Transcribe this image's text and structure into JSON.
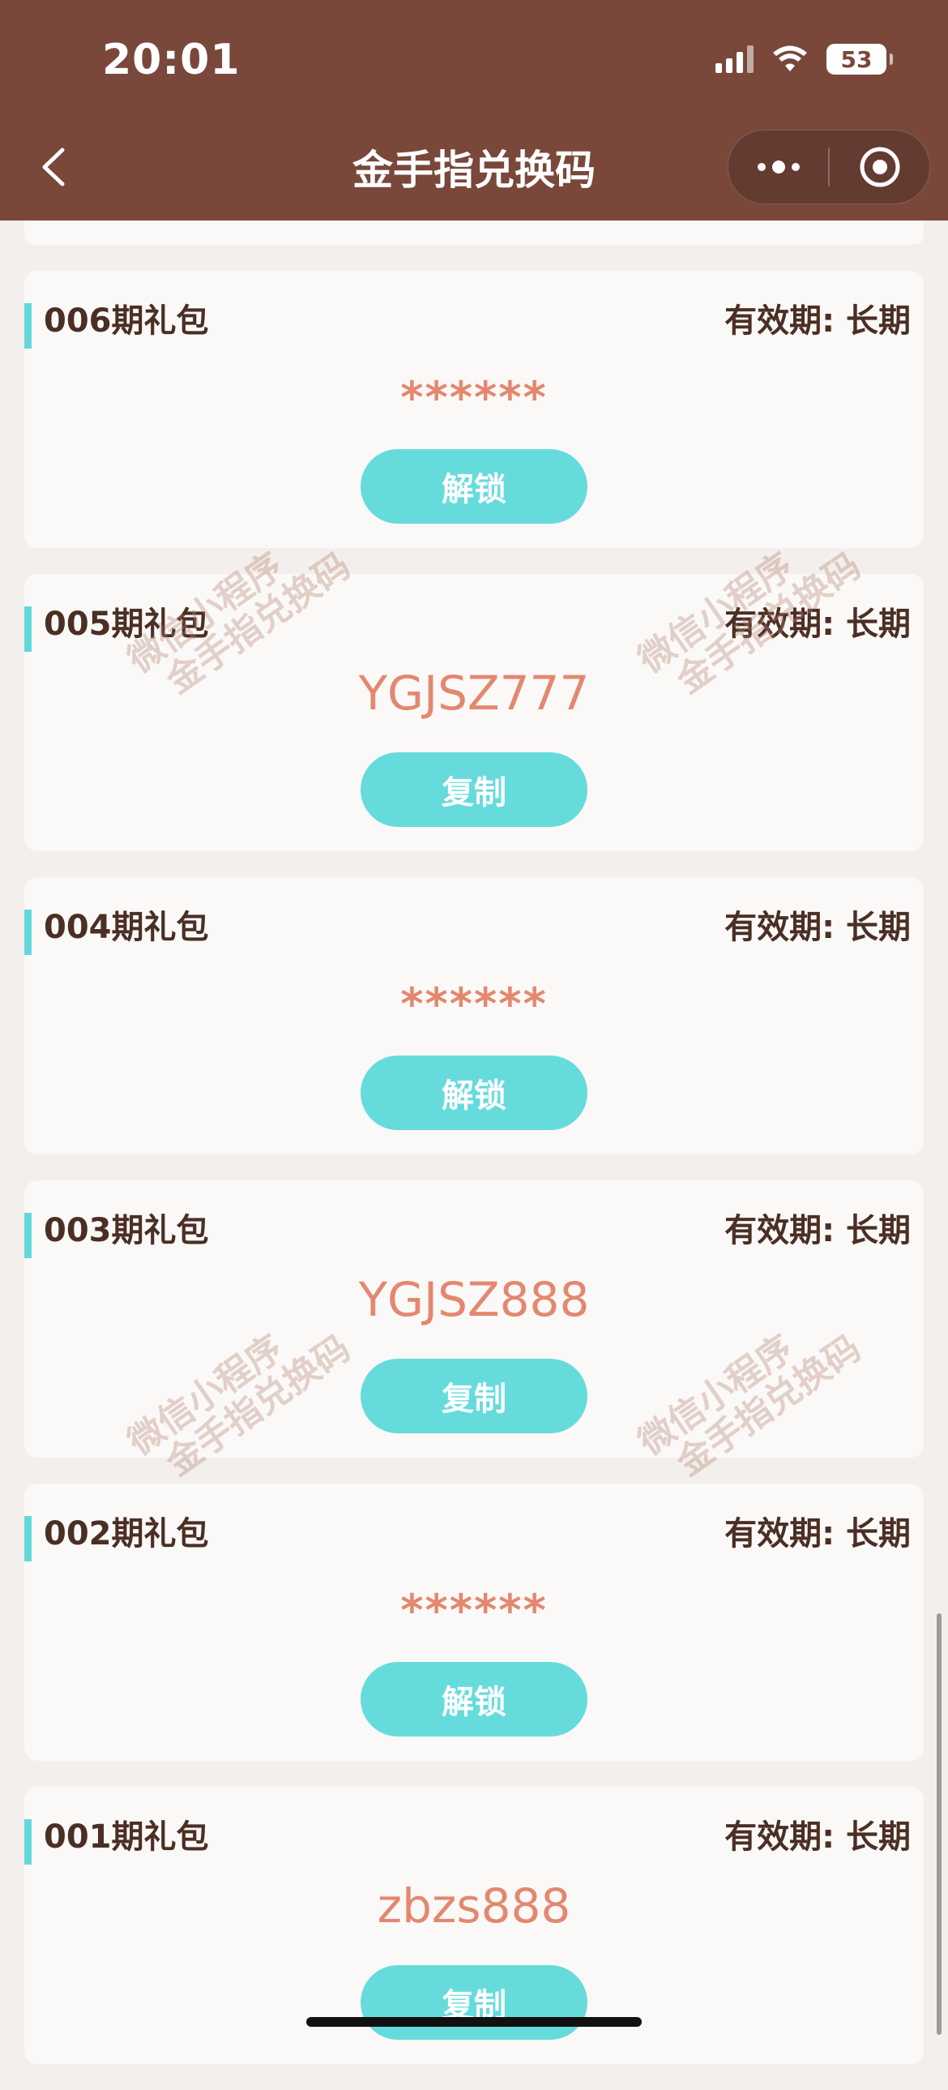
{
  "status": {
    "time": "20:01",
    "battery": "53"
  },
  "nav": {
    "title": "金手指兑换码"
  },
  "watermark": {
    "line1": "微信小程序",
    "line2": "金手指兑换码"
  },
  "cards": [
    {
      "title": "006期礼包",
      "expiry": "有效期: 长期",
      "code": "******",
      "button": "解锁",
      "masked": true
    },
    {
      "title": "005期礼包",
      "expiry": "有效期: 长期",
      "code": "YGJSZ777",
      "button": "复制",
      "masked": false
    },
    {
      "title": "004期礼包",
      "expiry": "有效期: 长期",
      "code": "******",
      "button": "解锁",
      "masked": true
    },
    {
      "title": "003期礼包",
      "expiry": "有效期: 长期",
      "code": "YGJSZ888",
      "button": "复制",
      "masked": false
    },
    {
      "title": "002期礼包",
      "expiry": "有效期: 长期",
      "code": "******",
      "button": "解锁",
      "masked": true
    },
    {
      "title": "001期礼包",
      "expiry": "有效期: 长期",
      "code": "zbzs888",
      "button": "复制",
      "masked": false
    }
  ]
}
